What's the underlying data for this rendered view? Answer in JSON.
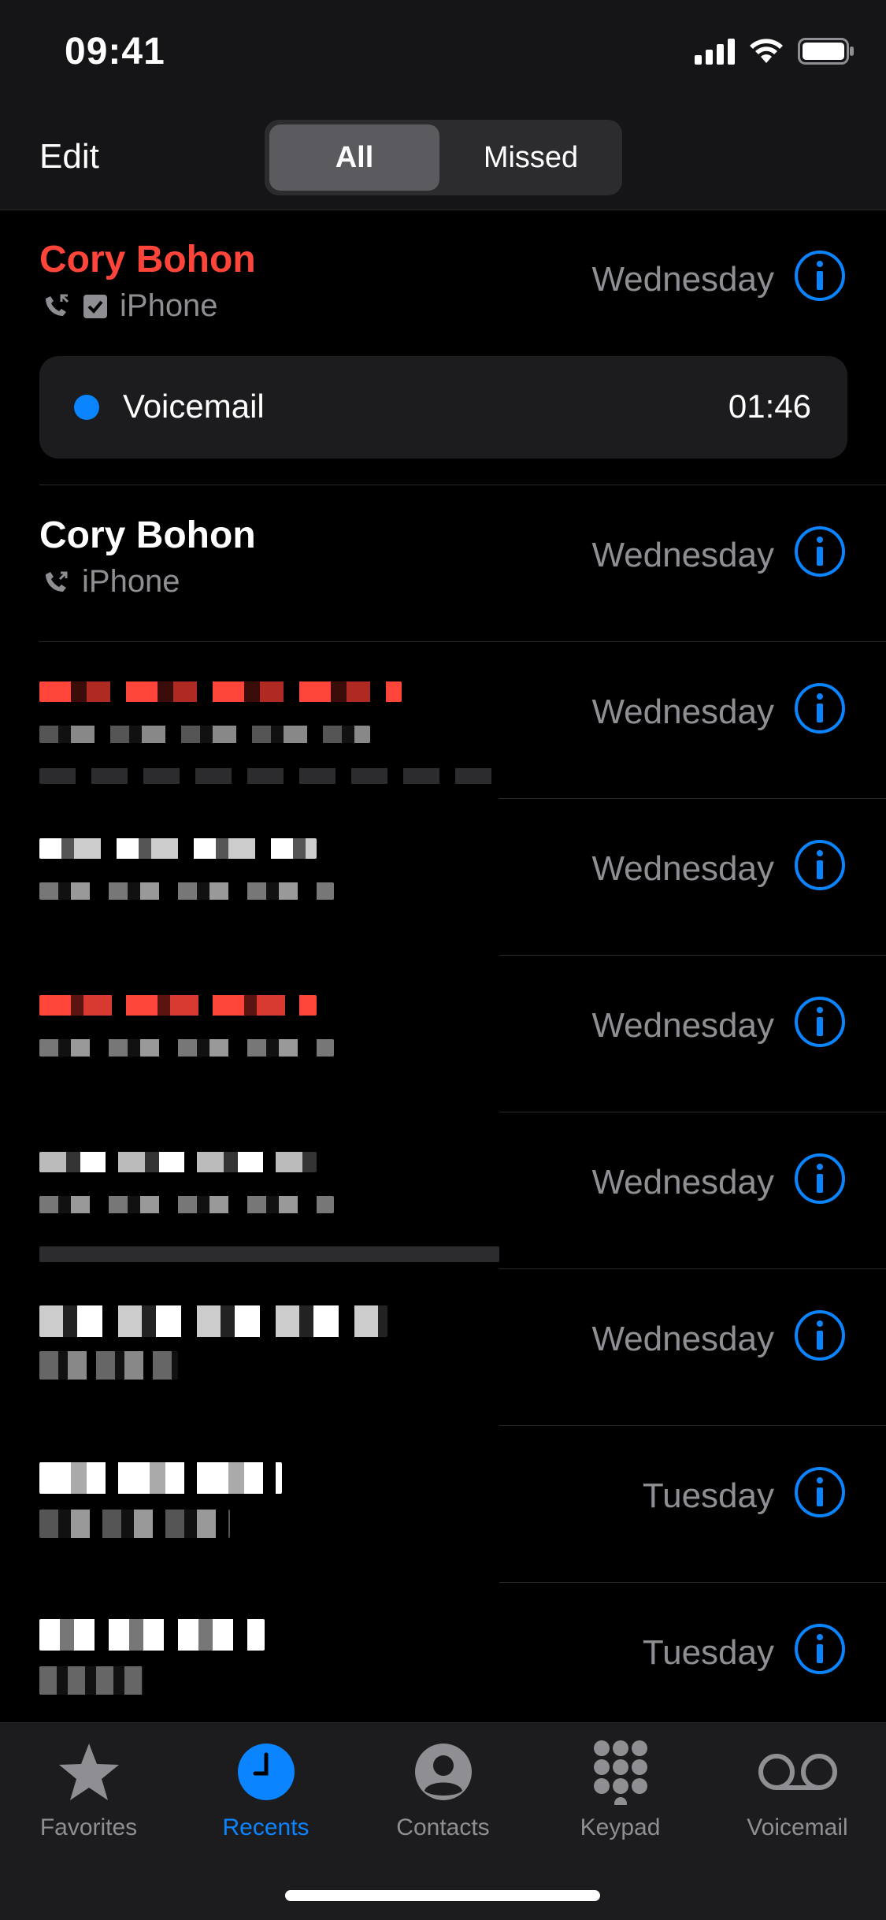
{
  "status": {
    "time": "09:41"
  },
  "nav": {
    "edit": "Edit",
    "segments": [
      "All",
      "Missed"
    ],
    "selected": "All"
  },
  "calls": [
    {
      "name": "Cory Bohon",
      "missed": true,
      "device": "iPhone",
      "date": "Wednesday"
    },
    {
      "name": "Cory Bohon",
      "missed": false,
      "device": "iPhone",
      "date": "Wednesday"
    },
    {
      "name": "",
      "missed": true,
      "device": "",
      "date": "Wednesday"
    },
    {
      "name": "",
      "missed": false,
      "device": "",
      "date": "Wednesday"
    },
    {
      "name": "",
      "missed": true,
      "device": "",
      "date": "Wednesday"
    },
    {
      "name": "",
      "missed": false,
      "device": "",
      "date": "Wednesday"
    },
    {
      "name": "",
      "missed": false,
      "device": "",
      "date": "Wednesday"
    },
    {
      "name": "",
      "missed": false,
      "device": "",
      "date": "Tuesday"
    },
    {
      "name": "",
      "missed": false,
      "device": "",
      "date": "Tuesday"
    }
  ],
  "voicemail": {
    "label": "Voicemail",
    "duration": "01:46"
  },
  "tabs": [
    {
      "label": "Favorites",
      "icon": "star-icon"
    },
    {
      "label": "Recents",
      "icon": "clock-icon",
      "active": true
    },
    {
      "label": "Contacts",
      "icon": "person-circle-icon"
    },
    {
      "label": "Keypad",
      "icon": "keypad-icon"
    },
    {
      "label": "Voicemail",
      "icon": "voicemail-icon"
    }
  ],
  "colors": {
    "accent": "#0a84ff",
    "missed": "#ff453a",
    "secondary": "#8e8e93"
  }
}
